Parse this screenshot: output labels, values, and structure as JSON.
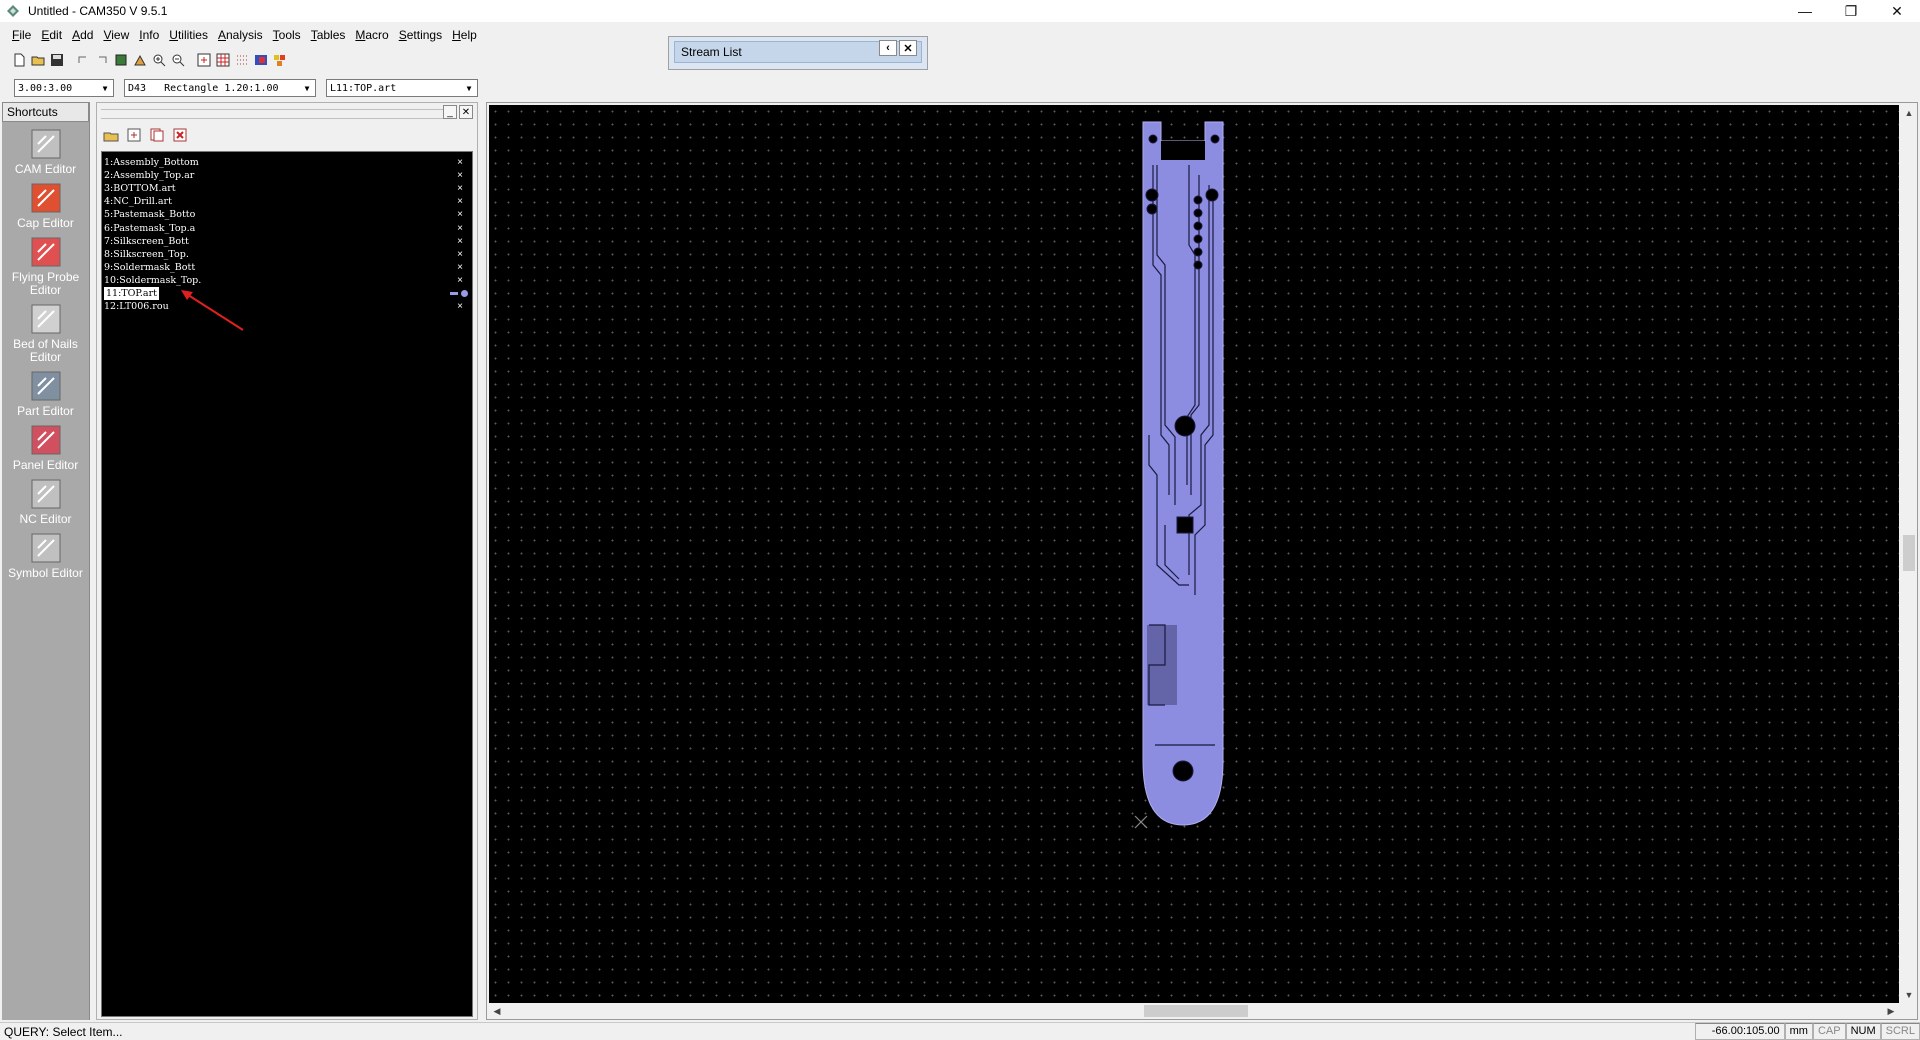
{
  "window": {
    "title": "Untitled - CAM350 V 9.5.1",
    "controls": [
      "—",
      "❐",
      "✕"
    ]
  },
  "menu": [
    "File",
    "Edit",
    "Add",
    "View",
    "Info",
    "Utilities",
    "Analysis",
    "Tools",
    "Tables",
    "Macro",
    "Settings",
    "Help"
  ],
  "toolbar": {
    "icons": [
      "new-file-icon",
      "open-icon",
      "save-icon",
      "undo-icon",
      "redo-icon",
      "redraw-icon",
      "pan-icon",
      "zoom-in-icon",
      "zoom-out-icon",
      "layer-select-icon",
      "grid-icon",
      "snap-grid-icon",
      "color-icon",
      "layers-icon"
    ]
  },
  "combos": {
    "grid": "3.00:3.00",
    "dcode": "D43   Rectangle 1.20:1.00",
    "layer": "L11:TOP.art"
  },
  "stream_list": {
    "title": "Stream List",
    "pin": "‹",
    "close": "✕"
  },
  "shortcuts": {
    "header": "Shortcuts",
    "items": [
      {
        "label": "CAM Editor",
        "icon": "cam-editor-icon"
      },
      {
        "label": "Cap Editor",
        "icon": "cap-editor-icon"
      },
      {
        "label": "Flying Probe Editor",
        "icon": "flying-probe-icon"
      },
      {
        "label": "Bed of Nails Editor",
        "icon": "bed-of-nails-icon"
      },
      {
        "label": "Part Editor",
        "icon": "part-editor-icon"
      },
      {
        "label": "Panel Editor",
        "icon": "panel-editor-icon"
      },
      {
        "label": "NC Editor",
        "icon": "nc-editor-icon"
      },
      {
        "label": "Symbol Editor",
        "icon": "symbol-editor-icon"
      }
    ]
  },
  "layers": {
    "items": [
      "1:Assembly_Bottom",
      "2:Assembly_Top.ar",
      "3:BOTTOM.art",
      "4:NC_Drill.art",
      "5:Pastemask_Botto",
      "6:Pastemask_Top.a",
      "7:Silkscreen_Bott",
      "8:Silkscreen_Top.",
      "9:Soldermask_Bott",
      "10:Soldermask_Top.",
      "11:TOP.art",
      "12:LT006.rou"
    ],
    "selected_index": 10,
    "selected_color": "#9a9ae6"
  },
  "status": {
    "prompt": "QUERY: Select Item...",
    "coords": "-66.00:105.00",
    "units": "mm",
    "cap": "CAP",
    "num": "NUM",
    "scrl": "SCRL"
  },
  "colors": {
    "board": "#8c8ce0",
    "annotation_arrow": "#e02020"
  }
}
